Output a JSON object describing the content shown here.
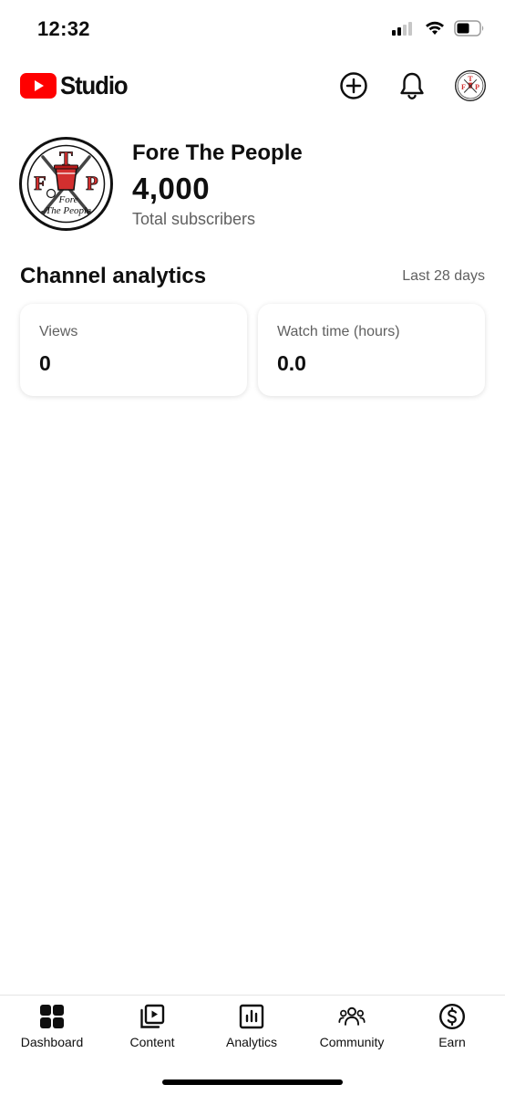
{
  "status_bar": {
    "time": "12:32",
    "icons": [
      "cellular-signal-icon",
      "wifi-icon",
      "battery-icon"
    ]
  },
  "header": {
    "logo_text": "Studio",
    "brand_color": "#ff0000",
    "actions": [
      "create-plus-icon",
      "notifications-bell-icon",
      "account-avatar"
    ]
  },
  "channel": {
    "name": "Fore The People",
    "subscriber_count": "4,000",
    "subscriber_label": "Total subscribers",
    "avatar_monogram": [
      "T",
      "F",
      "P"
    ],
    "avatar_script": [
      "Fore",
      "The People"
    ],
    "avatar_accent_color": "#d32f2f"
  },
  "analytics": {
    "title": "Channel analytics",
    "range": "Last 28 days",
    "cards": [
      {
        "label": "Views",
        "value": "0"
      },
      {
        "label": "Watch time (hours)",
        "value": "0.0"
      }
    ]
  },
  "bottom_nav": {
    "items": [
      {
        "label": "Dashboard",
        "icon": "dashboard-grid-icon",
        "active": true
      },
      {
        "label": "Content",
        "icon": "content-library-icon",
        "active": false
      },
      {
        "label": "Analytics",
        "icon": "analytics-chart-icon",
        "active": false
      },
      {
        "label": "Community",
        "icon": "community-people-icon",
        "active": false
      },
      {
        "label": "Earn",
        "icon": "earn-dollar-icon",
        "active": false
      }
    ]
  }
}
